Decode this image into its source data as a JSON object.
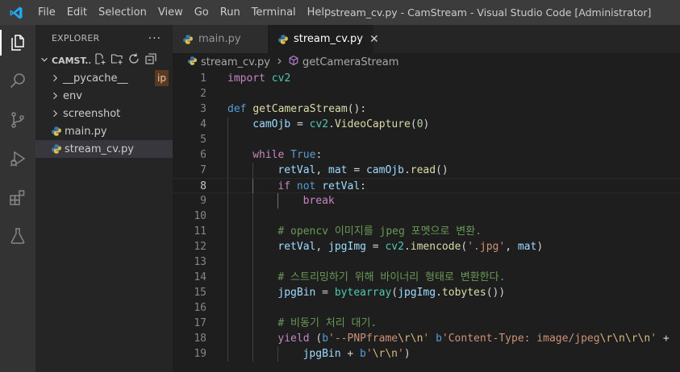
{
  "titlebar": {
    "menu": [
      "File",
      "Edit",
      "Selection",
      "View",
      "Go",
      "Run",
      "Terminal",
      "Help"
    ],
    "title": "stream_cv.py - CamStream - Visual Studio Code [Administrator]"
  },
  "sidebar": {
    "title": "EXPLORER",
    "more": "···",
    "section": "CAMST...",
    "items": [
      {
        "label": "__pycache__",
        "type": "folder"
      },
      {
        "label": "env",
        "type": "folder"
      },
      {
        "label": "screenshot",
        "type": "folder"
      },
      {
        "label": "main.py",
        "type": "file"
      },
      {
        "label": "stream_cv.py",
        "type": "file"
      }
    ],
    "hint": "ip"
  },
  "tabs": [
    {
      "label": "main.py",
      "active": false
    },
    {
      "label": "stream_cv.py",
      "active": true
    }
  ],
  "breadcrumb": {
    "file": "stream_cv.py",
    "symbol": "getCameraStream"
  },
  "editor": {
    "current_line": 8,
    "lines": [
      {
        "n": "1",
        "indent": 0,
        "tokens": [
          [
            "kw2",
            "import"
          ],
          [
            "pl",
            " "
          ],
          [
            "cls",
            "cv2"
          ]
        ]
      },
      {
        "n": "2",
        "indent": 0,
        "tokens": []
      },
      {
        "n": "3",
        "indent": 0,
        "tokens": [
          [
            "kw",
            "def"
          ],
          [
            "pl",
            " "
          ],
          [
            "fn",
            "getCameraStream"
          ],
          [
            "pl",
            "():"
          ]
        ]
      },
      {
        "n": "4",
        "indent": 1,
        "tokens": [
          [
            "var",
            "camOjb"
          ],
          [
            "pl",
            " = "
          ],
          [
            "cls",
            "cv2"
          ],
          [
            "pl",
            "."
          ],
          [
            "fn",
            "VideoCapture"
          ],
          [
            "pl",
            "("
          ],
          [
            "num",
            "0"
          ],
          [
            "pl",
            ")"
          ]
        ]
      },
      {
        "n": "5",
        "indent": 1,
        "tokens": []
      },
      {
        "n": "6",
        "indent": 1,
        "tokens": [
          [
            "kw2",
            "while"
          ],
          [
            "pl",
            " "
          ],
          [
            "kw",
            "True"
          ],
          [
            "pl",
            ":"
          ]
        ]
      },
      {
        "n": "7",
        "indent": 2,
        "tokens": [
          [
            "var",
            "retVal"
          ],
          [
            "pl",
            ", "
          ],
          [
            "var",
            "mat"
          ],
          [
            "pl",
            " = "
          ],
          [
            "var",
            "camOjb"
          ],
          [
            "pl",
            "."
          ],
          [
            "fn",
            "read"
          ],
          [
            "pl",
            "()"
          ]
        ]
      },
      {
        "n": "8",
        "indent": 2,
        "tokens": [
          [
            "kw2",
            "if"
          ],
          [
            "pl",
            " "
          ],
          [
            "kw",
            "not"
          ],
          [
            "pl",
            " "
          ],
          [
            "var",
            "retVal"
          ],
          [
            "pl",
            ":"
          ]
        ]
      },
      {
        "n": "9",
        "indent": 3,
        "tokens": [
          [
            "kw2",
            "break"
          ]
        ]
      },
      {
        "n": "10",
        "indent": 2,
        "tokens": []
      },
      {
        "n": "11",
        "indent": 2,
        "tokens": [
          [
            "cmt",
            "# opencv 이미지를 jpeg 포멧으로 변환."
          ]
        ]
      },
      {
        "n": "12",
        "indent": 2,
        "tokens": [
          [
            "var",
            "retVal"
          ],
          [
            "pl",
            ", "
          ],
          [
            "var",
            "jpgImg"
          ],
          [
            "pl",
            " = "
          ],
          [
            "cls",
            "cv2"
          ],
          [
            "pl",
            "."
          ],
          [
            "fn",
            "imencode"
          ],
          [
            "pl",
            "("
          ],
          [
            "str",
            "'.jpg'"
          ],
          [
            "pl",
            ", "
          ],
          [
            "var",
            "mat"
          ],
          [
            "pl",
            ")"
          ]
        ]
      },
      {
        "n": "13",
        "indent": 2,
        "tokens": []
      },
      {
        "n": "14",
        "indent": 2,
        "tokens": [
          [
            "cmt",
            "# 스트리밍하기 위해 바이너리 형태로 변환한다."
          ]
        ]
      },
      {
        "n": "15",
        "indent": 2,
        "tokens": [
          [
            "var",
            "jpgBin"
          ],
          [
            "pl",
            " = "
          ],
          [
            "cls",
            "bytearray"
          ],
          [
            "pl",
            "("
          ],
          [
            "var",
            "jpgImg"
          ],
          [
            "pl",
            "."
          ],
          [
            "fn",
            "tobytes"
          ],
          [
            "pl",
            "())"
          ]
        ]
      },
      {
        "n": "16",
        "indent": 2,
        "tokens": []
      },
      {
        "n": "17",
        "indent": 2,
        "tokens": [
          [
            "cmt",
            "# 비동기 처리 대기."
          ]
        ]
      },
      {
        "n": "18",
        "indent": 2,
        "tokens": [
          [
            "kw2",
            "yield"
          ],
          [
            "pl",
            " ("
          ],
          [
            "kw",
            "b"
          ],
          [
            "str",
            "'--PNPframe"
          ],
          [
            "esc",
            "\\r\\n"
          ],
          [
            "str",
            "'"
          ],
          [
            "pl",
            " "
          ],
          [
            "kw",
            "b"
          ],
          [
            "str",
            "'Content-Type: image/jpeg"
          ],
          [
            "esc",
            "\\r\\n\\r\\n"
          ],
          [
            "str",
            "'"
          ],
          [
            "pl",
            " +"
          ]
        ]
      },
      {
        "n": "19",
        "indent": 3,
        "tokens": [
          [
            "var",
            "jpgBin"
          ],
          [
            "pl",
            " + "
          ],
          [
            "kw",
            "b"
          ],
          [
            "str",
            "'"
          ],
          [
            "esc",
            "\\r\\n"
          ],
          [
            "str",
            "'"
          ],
          [
            "pl",
            ")"
          ]
        ]
      }
    ]
  },
  "colors": {
    "titlebar": "#3c3c3c",
    "activitybar": "#333333",
    "sidebar": "#252526",
    "editor": "#1e1e1e",
    "python_blue": "#3c78aa",
    "python_yellow": "#e0c050"
  }
}
